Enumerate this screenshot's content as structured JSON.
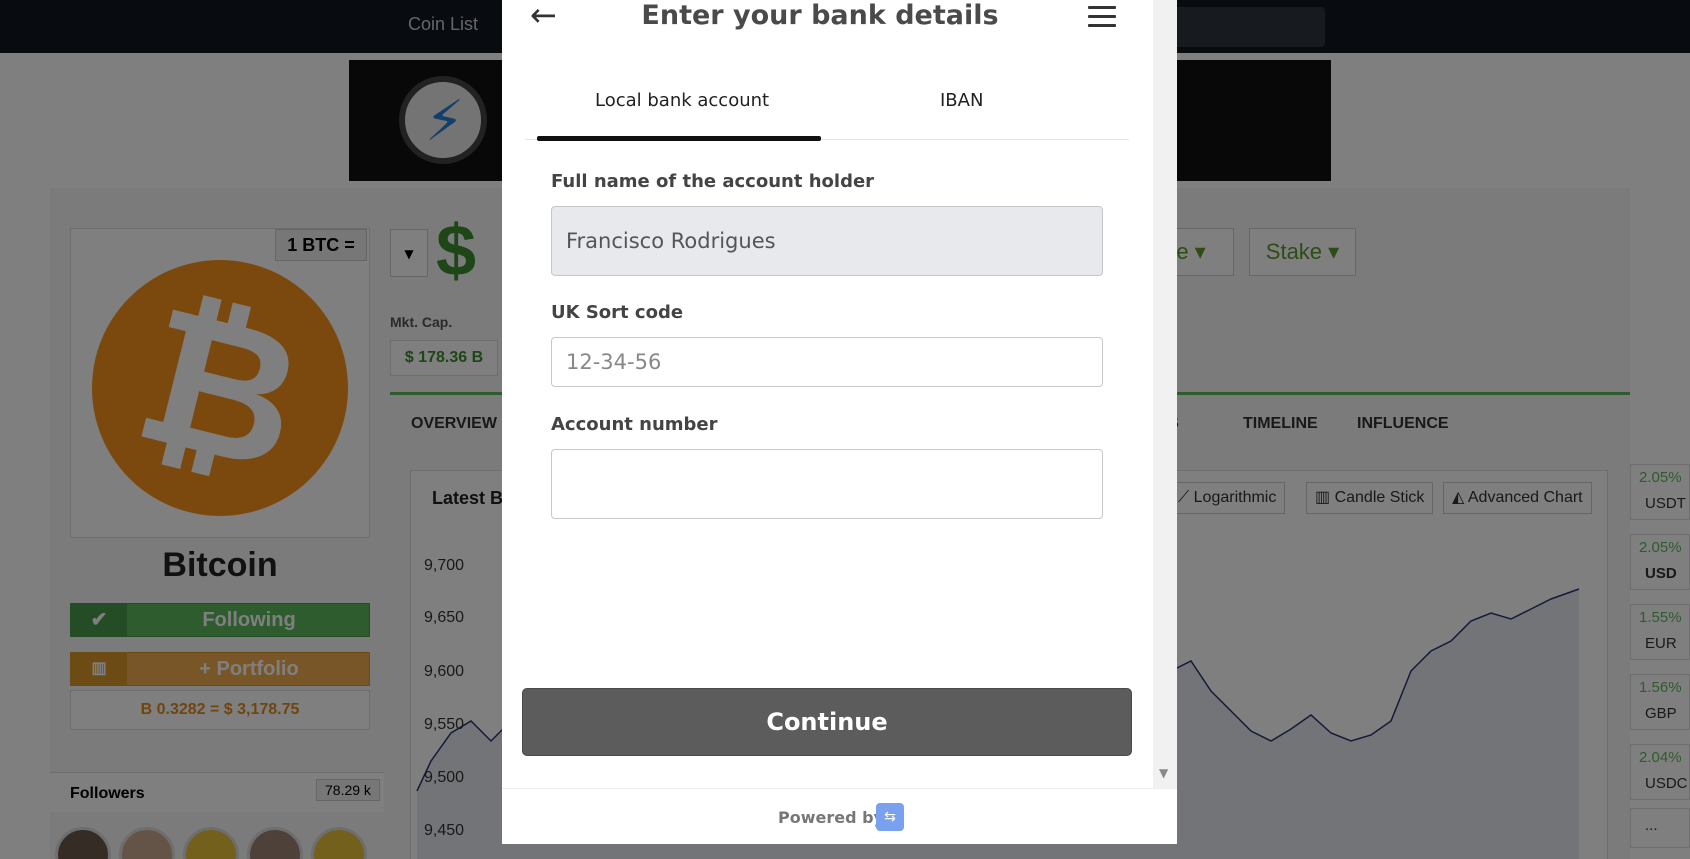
{
  "background": {
    "nav": {
      "coin_list": "Coin List"
    },
    "coin": {
      "rate_label": "1 BTC =",
      "symbol": "$",
      "name": "Bitcoin",
      "following_label": "Following",
      "portfolio_label": "+ Portfolio",
      "holding": "B 0.3282 = $ 3,178.75",
      "mkt_cap_label": "Mkt. Cap.",
      "mkt_cap_value": "$ 178.36 B"
    },
    "followers": {
      "label": "Followers",
      "count": "78.29 k"
    },
    "actions": {
      "more": "re",
      "stake": "Stake"
    },
    "tabs": [
      "OVERVIEW",
      "WS",
      "TIMELINE",
      "INFLUENCE"
    ],
    "chart": {
      "title": "Latest Bit",
      "buttons": [
        "Logarithmic",
        "Candle Stick",
        "Advanced Chart"
      ],
      "yticks": [
        "9,700",
        "9,650",
        "9,600",
        "9,550",
        "9,500",
        "9,450"
      ]
    },
    "side_pairs": [
      {
        "pct": "2.05%",
        "name": "USDT"
      },
      {
        "pct": "2.05%",
        "name": "USD"
      },
      {
        "pct": "1.55%",
        "name": "EUR"
      },
      {
        "pct": "1.56%",
        "name": "GBP"
      },
      {
        "pct": "2.04%",
        "name": "USDC"
      }
    ],
    "side_more": "..."
  },
  "modal": {
    "title": "Enter your bank details",
    "tabs": {
      "local": "Local bank account",
      "iban": "IBAN"
    },
    "fields": {
      "holder_label": "Full name of the account holder",
      "holder_value": "Francisco Rodrigues",
      "sort_label": "UK Sort code",
      "sort_placeholder": "12-34-56",
      "account_label": "Account number",
      "account_value": ""
    },
    "continue_label": "Continue",
    "powered_by": "Powered by"
  },
  "colors": {
    "accent_tab": "#111111",
    "continue_bg": "#5c5c5c",
    "bitcoin_orange": "#f7931a"
  }
}
